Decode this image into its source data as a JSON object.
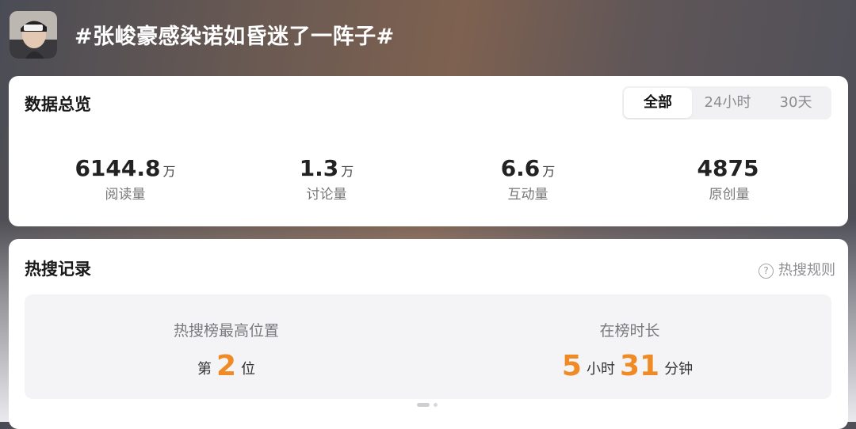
{
  "header": {
    "topic_title": "#张峻豪感染诺如昏迷了一阵子#"
  },
  "overview": {
    "title": "数据总览",
    "tabs": [
      {
        "label": "全部",
        "selected": true
      },
      {
        "label": "24小时",
        "selected": false
      },
      {
        "label": "30天",
        "selected": false
      }
    ],
    "stats": [
      {
        "value": "6144.8",
        "unit": "万",
        "label": "阅读量"
      },
      {
        "value": "1.3",
        "unit": "万",
        "label": "讨论量"
      },
      {
        "value": "6.6",
        "unit": "万",
        "label": "互动量"
      },
      {
        "value": "4875",
        "unit": "",
        "label": "原创量"
      }
    ]
  },
  "hot": {
    "title": "热搜记录",
    "rules_label": "热搜规则",
    "rules_icon": "question-circle-icon",
    "highest": {
      "label": "热搜榜最高位置",
      "prefix": "第",
      "value": "2",
      "suffix": "位"
    },
    "duration": {
      "label": "在榜时长",
      "hours": "5",
      "hours_unit": "小时",
      "minutes": "31",
      "minutes_unit": "分钟"
    }
  },
  "colors": {
    "accent": "#f08a24",
    "card_bg": "#ffffff",
    "inner_bg": "#f4f4f6"
  }
}
